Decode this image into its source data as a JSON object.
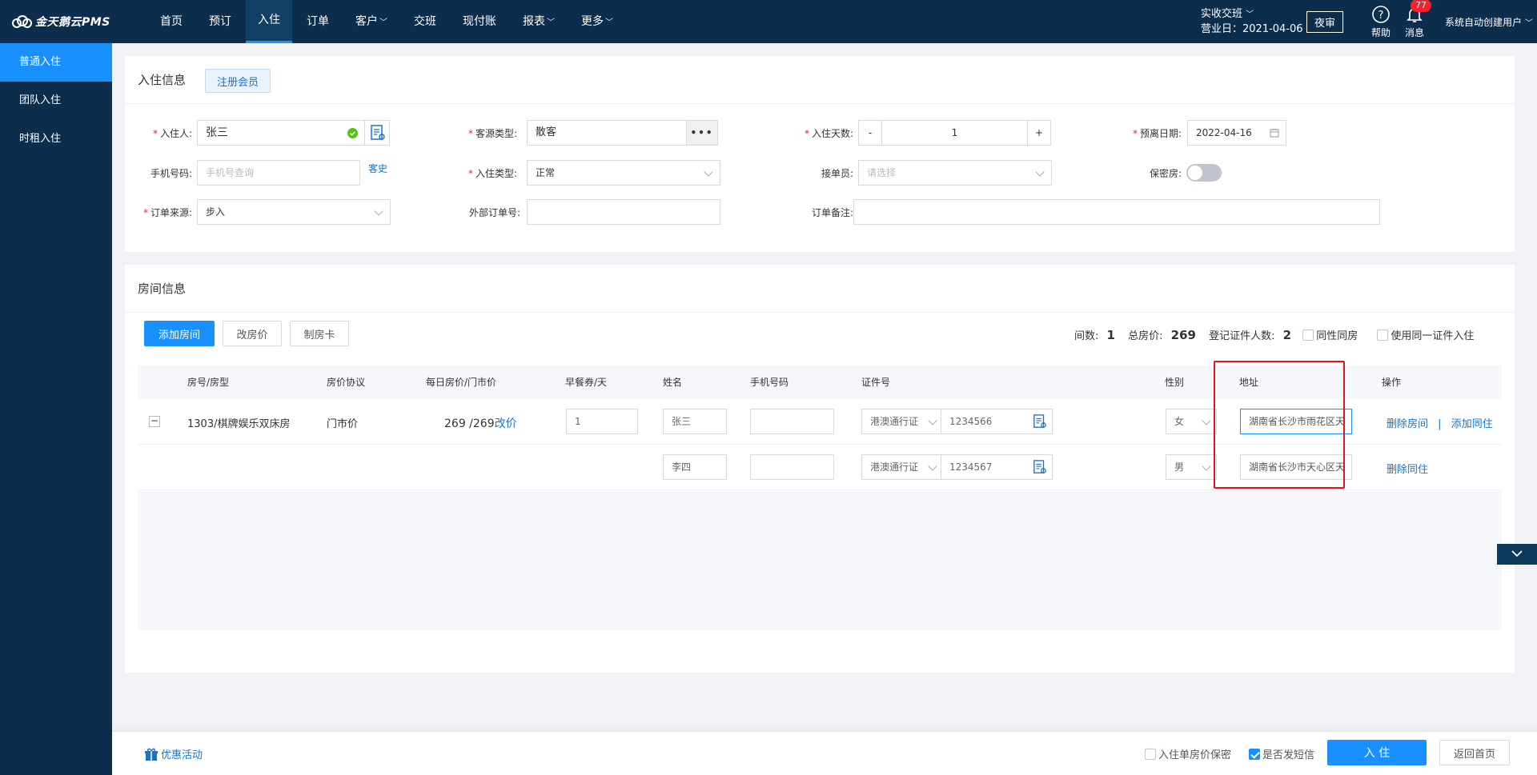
{
  "app": {
    "logo": "金天鹅云PMS"
  },
  "nav": [
    {
      "label": "首页"
    },
    {
      "label": "预订"
    },
    {
      "label": "入住",
      "active": true
    },
    {
      "label": "订单"
    },
    {
      "label": "客户",
      "caret": true
    },
    {
      "label": "交班"
    },
    {
      "label": "现付账"
    },
    {
      "label": "报表",
      "caret": true
    },
    {
      "label": "更多",
      "caret": true
    }
  ],
  "topright": {
    "shift": "实收交班",
    "business_day": "营业日：2021-04-06",
    "night_audit": "夜审",
    "help": "帮助",
    "messages": "消息",
    "message_count": "77",
    "user": "系统自动创建用户"
  },
  "sidebar": [
    {
      "label": "普通入住",
      "active": true
    },
    {
      "label": "团队入住"
    },
    {
      "label": "时租入住"
    }
  ],
  "checkin": {
    "title": "入住信息",
    "register_member": "注册会员",
    "guest_label": "入住人:",
    "guest_value": "张三",
    "source_type_label": "客源类型:",
    "source_type_value": "散客",
    "days_label": "入住天数:",
    "days_minus": "-",
    "days_value": "1",
    "days_plus": "+",
    "depart_label": "预离日期:",
    "depart_value": "2022-04-16",
    "phone_label": "手机号码:",
    "phone_placeholder": "手机号查询",
    "history_link": "客史",
    "checkin_type_label": "入住类型:",
    "checkin_type_value": "正常",
    "receiver_label": "接单员:",
    "receiver_placeholder": "请选择",
    "secret_label": "保密房:",
    "order_source_label": "订单来源:",
    "order_source_value": "步入",
    "ext_order_label": "外部订单号:",
    "remark_label": "订单备注:"
  },
  "rooms": {
    "title": "房间信息",
    "add_room": "添加房间",
    "change_price": "改房价",
    "make_card": "制房卡",
    "room_count_label": "间数:",
    "room_count": "1",
    "total_label": "总房价:",
    "total": "269",
    "id_count_label": "登记证件人数:",
    "id_count": "2",
    "same_sex": "同性同房",
    "same_id": "使用同一证件入住",
    "headers": [
      "房号/房型",
      "房价协议",
      "每日房价/门市价",
      "早餐券/天",
      "姓名",
      "手机号码",
      "证件号",
      "性别",
      "地址",
      "操作"
    ],
    "rows": [
      {
        "toggle": "−",
        "room": "1303/棋牌娱乐双床房",
        "protocol": "门市价",
        "price": "269 /269",
        "price_link": "改价",
        "breakfast": "1",
        "name": "张三",
        "phone": "",
        "id_type": "港澳通行证",
        "id_no": "1234566",
        "gender": "女",
        "address": "湖南省长沙市雨花区天",
        "action1": "删除房间",
        "sep": "|",
        "action2": "添加同住"
      },
      {
        "name": "李四",
        "phone": "",
        "id_type": "港澳通行证",
        "id_no": "1234567",
        "gender": "男",
        "address": "湖南省长沙市天心区天",
        "action1": "删除同住"
      }
    ]
  },
  "footer": {
    "promo": "优惠活动",
    "price_secret": "入住单房价保密",
    "send_sms": "是否发短信",
    "checkin_btn": "入 住",
    "back_btn": "返回首页"
  },
  "colors": {
    "primary": "#1890ff",
    "nav_bg": "#0d2d4d",
    "highlight_border": "#e0141e"
  }
}
